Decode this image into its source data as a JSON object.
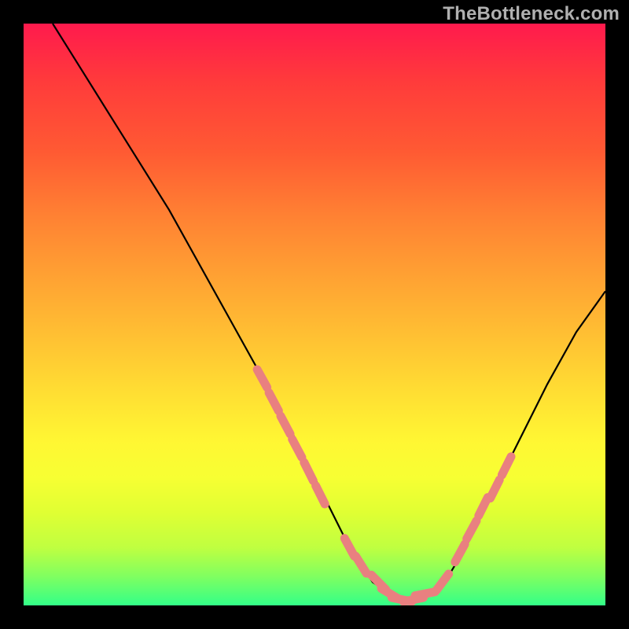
{
  "watermark": "TheBottleneck.com",
  "chart_data": {
    "type": "line",
    "title": "",
    "xlabel": "",
    "ylabel": "",
    "xlim": [
      0,
      100
    ],
    "ylim": [
      0,
      100
    ],
    "grid": false,
    "series": [
      {
        "name": "bottleneck-curve",
        "color": "#000000",
        "x": [
          5,
          10,
          15,
          20,
          25,
          30,
          35,
          40,
          45,
          50,
          52,
          55,
          58,
          60,
          63,
          65,
          68,
          70,
          73,
          76,
          80,
          85,
          90,
          95,
          100
        ],
        "y": [
          100,
          92,
          84,
          76,
          68,
          59,
          50,
          41,
          32,
          22,
          18,
          12,
          7,
          4,
          2,
          1,
          1,
          2,
          5,
          10,
          18,
          28,
          38,
          47,
          54
        ]
      }
    ],
    "highlight_points": {
      "name": "highlight-segments",
      "color": "#e98080",
      "x": [
        41,
        43,
        45,
        47,
        49,
        51,
        56,
        58,
        61,
        63,
        65,
        67,
        69,
        72,
        75,
        77,
        79,
        81,
        83
      ],
      "y": [
        39,
        35,
        31,
        27,
        23,
        19,
        10,
        7,
        4,
        2,
        1,
        1,
        2,
        4,
        9,
        13,
        17,
        20,
        24
      ]
    }
  }
}
